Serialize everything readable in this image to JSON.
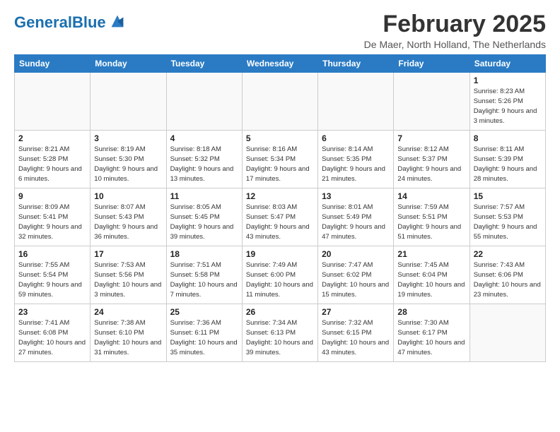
{
  "header": {
    "logo_general": "General",
    "logo_blue": "Blue",
    "month": "February 2025",
    "location": "De Maer, North Holland, The Netherlands"
  },
  "weekdays": [
    "Sunday",
    "Monday",
    "Tuesday",
    "Wednesday",
    "Thursday",
    "Friday",
    "Saturday"
  ],
  "weeks": [
    [
      {
        "day": "",
        "info": ""
      },
      {
        "day": "",
        "info": ""
      },
      {
        "day": "",
        "info": ""
      },
      {
        "day": "",
        "info": ""
      },
      {
        "day": "",
        "info": ""
      },
      {
        "day": "",
        "info": ""
      },
      {
        "day": "1",
        "info": "Sunrise: 8:23 AM\nSunset: 5:26 PM\nDaylight: 9 hours and 3 minutes."
      }
    ],
    [
      {
        "day": "2",
        "info": "Sunrise: 8:21 AM\nSunset: 5:28 PM\nDaylight: 9 hours and 6 minutes."
      },
      {
        "day": "3",
        "info": "Sunrise: 8:19 AM\nSunset: 5:30 PM\nDaylight: 9 hours and 10 minutes."
      },
      {
        "day": "4",
        "info": "Sunrise: 8:18 AM\nSunset: 5:32 PM\nDaylight: 9 hours and 13 minutes."
      },
      {
        "day": "5",
        "info": "Sunrise: 8:16 AM\nSunset: 5:34 PM\nDaylight: 9 hours and 17 minutes."
      },
      {
        "day": "6",
        "info": "Sunrise: 8:14 AM\nSunset: 5:35 PM\nDaylight: 9 hours and 21 minutes."
      },
      {
        "day": "7",
        "info": "Sunrise: 8:12 AM\nSunset: 5:37 PM\nDaylight: 9 hours and 24 minutes."
      },
      {
        "day": "8",
        "info": "Sunrise: 8:11 AM\nSunset: 5:39 PM\nDaylight: 9 hours and 28 minutes."
      }
    ],
    [
      {
        "day": "9",
        "info": "Sunrise: 8:09 AM\nSunset: 5:41 PM\nDaylight: 9 hours and 32 minutes."
      },
      {
        "day": "10",
        "info": "Sunrise: 8:07 AM\nSunset: 5:43 PM\nDaylight: 9 hours and 36 minutes."
      },
      {
        "day": "11",
        "info": "Sunrise: 8:05 AM\nSunset: 5:45 PM\nDaylight: 9 hours and 39 minutes."
      },
      {
        "day": "12",
        "info": "Sunrise: 8:03 AM\nSunset: 5:47 PM\nDaylight: 9 hours and 43 minutes."
      },
      {
        "day": "13",
        "info": "Sunrise: 8:01 AM\nSunset: 5:49 PM\nDaylight: 9 hours and 47 minutes."
      },
      {
        "day": "14",
        "info": "Sunrise: 7:59 AM\nSunset: 5:51 PM\nDaylight: 9 hours and 51 minutes."
      },
      {
        "day": "15",
        "info": "Sunrise: 7:57 AM\nSunset: 5:53 PM\nDaylight: 9 hours and 55 minutes."
      }
    ],
    [
      {
        "day": "16",
        "info": "Sunrise: 7:55 AM\nSunset: 5:54 PM\nDaylight: 9 hours and 59 minutes."
      },
      {
        "day": "17",
        "info": "Sunrise: 7:53 AM\nSunset: 5:56 PM\nDaylight: 10 hours and 3 minutes."
      },
      {
        "day": "18",
        "info": "Sunrise: 7:51 AM\nSunset: 5:58 PM\nDaylight: 10 hours and 7 minutes."
      },
      {
        "day": "19",
        "info": "Sunrise: 7:49 AM\nSunset: 6:00 PM\nDaylight: 10 hours and 11 minutes."
      },
      {
        "day": "20",
        "info": "Sunrise: 7:47 AM\nSunset: 6:02 PM\nDaylight: 10 hours and 15 minutes."
      },
      {
        "day": "21",
        "info": "Sunrise: 7:45 AM\nSunset: 6:04 PM\nDaylight: 10 hours and 19 minutes."
      },
      {
        "day": "22",
        "info": "Sunrise: 7:43 AM\nSunset: 6:06 PM\nDaylight: 10 hours and 23 minutes."
      }
    ],
    [
      {
        "day": "23",
        "info": "Sunrise: 7:41 AM\nSunset: 6:08 PM\nDaylight: 10 hours and 27 minutes."
      },
      {
        "day": "24",
        "info": "Sunrise: 7:38 AM\nSunset: 6:10 PM\nDaylight: 10 hours and 31 minutes."
      },
      {
        "day": "25",
        "info": "Sunrise: 7:36 AM\nSunset: 6:11 PM\nDaylight: 10 hours and 35 minutes."
      },
      {
        "day": "26",
        "info": "Sunrise: 7:34 AM\nSunset: 6:13 PM\nDaylight: 10 hours and 39 minutes."
      },
      {
        "day": "27",
        "info": "Sunrise: 7:32 AM\nSunset: 6:15 PM\nDaylight: 10 hours and 43 minutes."
      },
      {
        "day": "28",
        "info": "Sunrise: 7:30 AM\nSunset: 6:17 PM\nDaylight: 10 hours and 47 minutes."
      },
      {
        "day": "",
        "info": ""
      }
    ]
  ]
}
